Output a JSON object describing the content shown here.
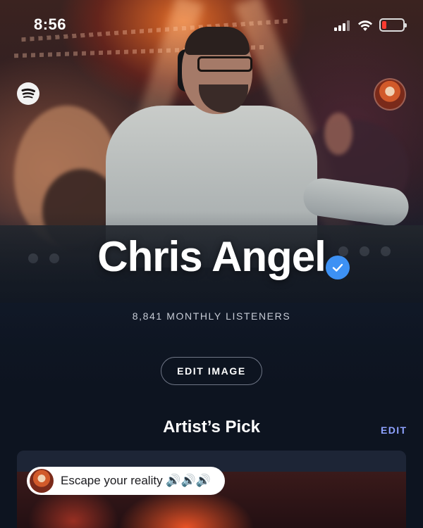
{
  "status_bar": {
    "time": "8:56"
  },
  "artist": {
    "name": "Chris Angel",
    "monthly_listeners": "8,841 MONTHLY LISTENERS"
  },
  "actions": {
    "edit_image": "EDIT IMAGE"
  },
  "artists_pick": {
    "title": "Artist’s Pick",
    "edit_label": "EDIT",
    "caption": "Escape your reality 🔊🔊🔊"
  },
  "icons": {
    "top_left": "spotify-logo-icon",
    "top_right": "profile-avatar",
    "verified": "verified-check-icon"
  },
  "colors": {
    "verified_badge": "#3d91f4",
    "edit_link": "#8ea2ff",
    "battery_low": "#ff3b30",
    "background": "#0d1420"
  }
}
